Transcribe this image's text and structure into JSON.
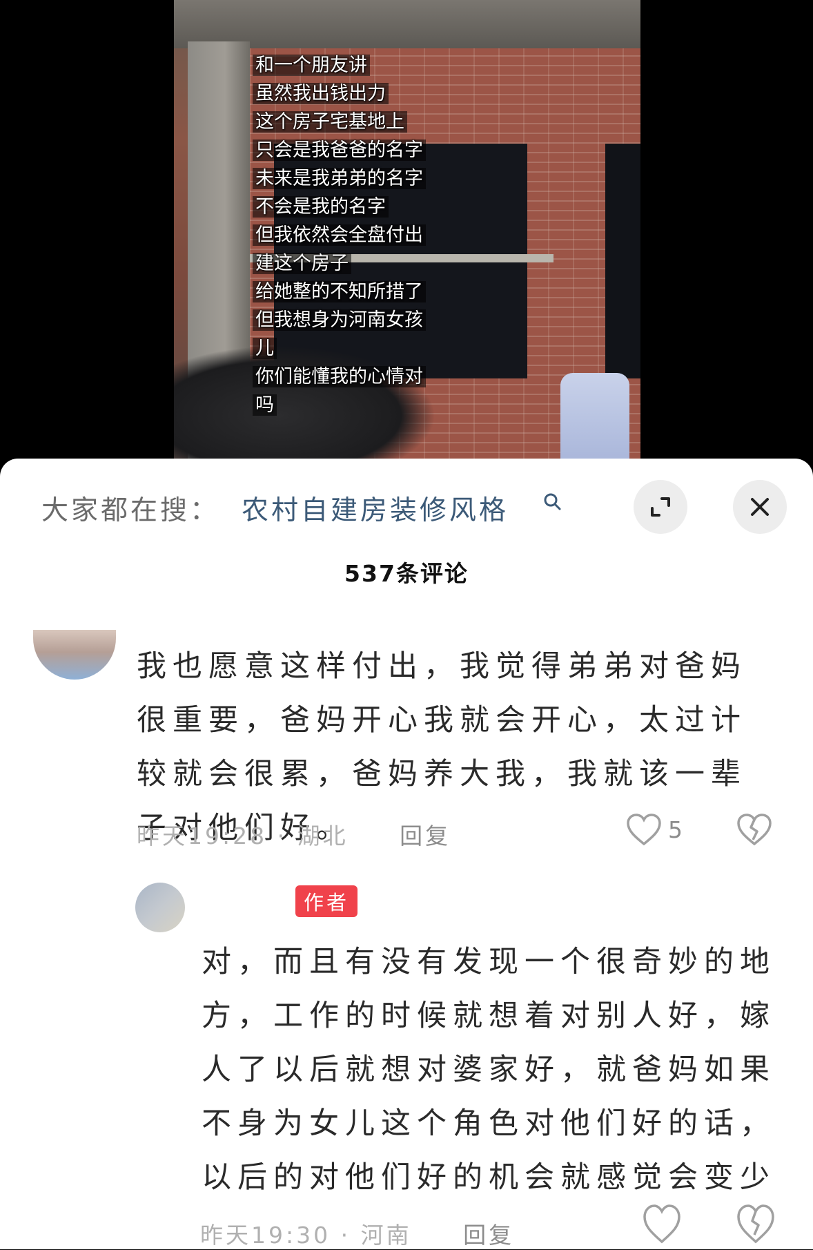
{
  "video": {
    "caption_lines": [
      "和一个朋友讲",
      "虽然我出钱出力",
      "这个房子宅基地上",
      "只会是我爸爸的名字",
      "未来是我弟弟的名字",
      "不会是我的名字",
      "但我依然会全盘付出",
      "建这个房子",
      "给她整的不知所措了",
      "但我想身为河南女孩",
      "儿",
      "你们能懂我的心情对",
      "吗"
    ]
  },
  "search": {
    "prefix": "大家都在搜：",
    "term": "农村自建房装修风格",
    "icon": "search-icon"
  },
  "header": {
    "comment_count": "537条评论"
  },
  "comments": [
    {
      "text": "我也愿意这样付出，我觉得弟弟对爸妈很重要，爸妈开心我就会开心，太过计较就会很累，爸妈养大我，我就该一辈子对他们好。",
      "time": "昨天19:28",
      "location": "湖北",
      "reply_label": "回复",
      "likes": "5"
    }
  ],
  "reply": {
    "badge": "作者",
    "text": "对，而且有没有发现一个很奇妙的地方，工作的时候就想着对别人好，嫁人了以后就想对婆家好，就爸妈如果不身为女儿这个角色对他们好的话，以后的对他们好的机会就感觉会变少",
    "time": "昨天19:30",
    "location": "河南",
    "reply_label": "回复"
  },
  "colors": {
    "search_term": "#3c5a78",
    "author_badge": "#f0424b",
    "meta_text": "#b0b0b0"
  }
}
